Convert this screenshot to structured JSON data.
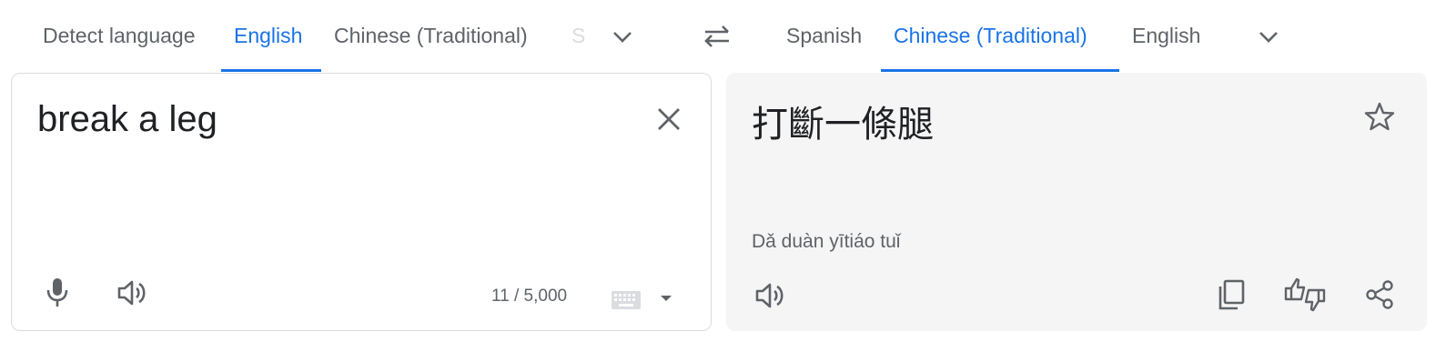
{
  "source_languages": {
    "tabs": [
      {
        "label": "Detect language",
        "active": false
      },
      {
        "label": "English",
        "active": true
      },
      {
        "label": "Chinese (Traditional)",
        "active": false
      },
      {
        "label": "S",
        "active": false
      }
    ]
  },
  "target_languages": {
    "tabs": [
      {
        "label": "Spanish",
        "active": false
      },
      {
        "label": "Chinese (Traditional)",
        "active": true
      },
      {
        "label": "English",
        "active": false
      }
    ]
  },
  "source": {
    "text": "break a leg",
    "char_count": "11 / 5,000"
  },
  "target": {
    "text": "打斷一條腿",
    "transliteration": "Dǎ duàn yītiáo tuǐ"
  },
  "icons": {
    "more_source": "chevron-down-icon",
    "swap": "swap-arrows-icon",
    "more_target": "chevron-down-icon",
    "clear": "close-icon",
    "mic": "microphone-icon",
    "listen": "speaker-icon",
    "keyboard": "keyboard-icon",
    "star": "star-icon",
    "copy": "copy-icon",
    "feedback": "thumbs-feedback-icon",
    "share": "share-icon"
  },
  "colors": {
    "accent": "#1a73e8",
    "text": "#202124",
    "muted": "#5f6368",
    "target_bg": "#f5f5f5",
    "border": "#dadce0"
  }
}
